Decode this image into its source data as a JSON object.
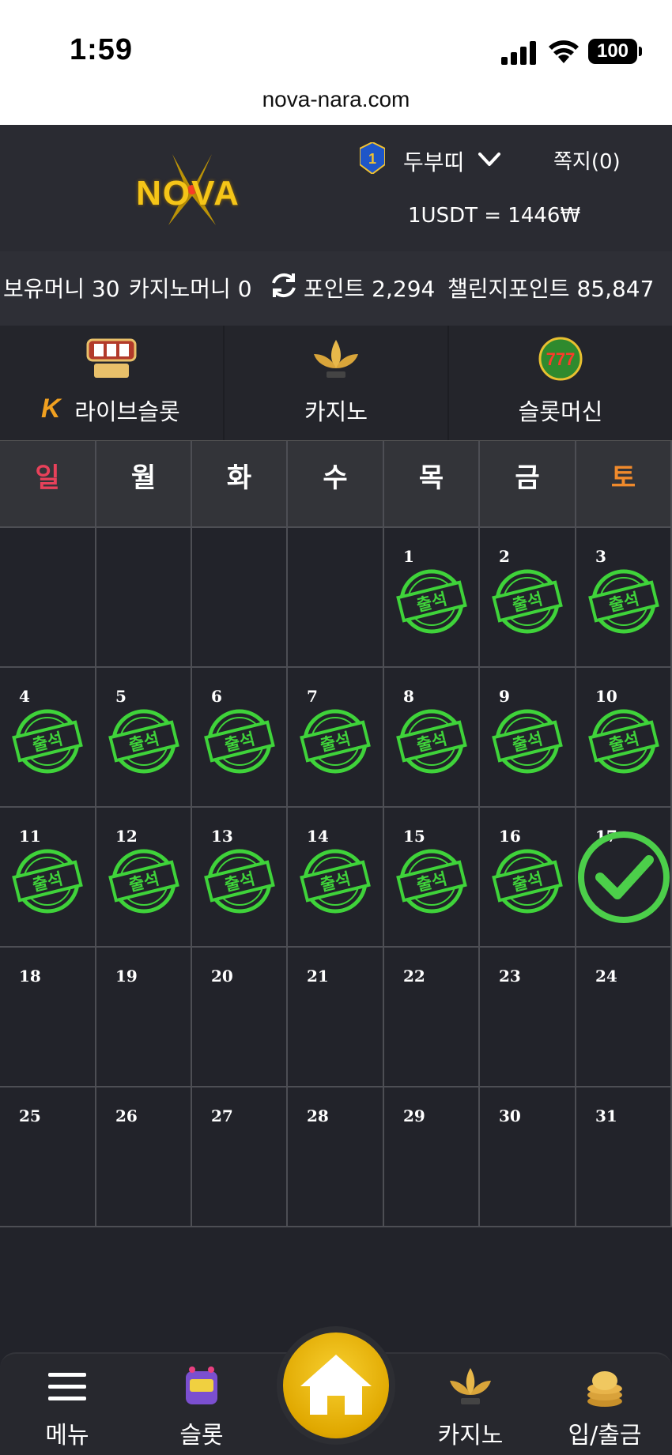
{
  "status_bar": {
    "time": "1:59",
    "battery": "100"
  },
  "browser": {
    "url": "nova-nara.com"
  },
  "header": {
    "logo_text": "NOVA",
    "rank_level": "1",
    "username": "두부띠",
    "messages": "쪽지(0)",
    "exchange_rate": "1USDT = 1446₩"
  },
  "balances": {
    "holding": "보유머니 30",
    "casino": "카지노머니 0",
    "points": "포인트 2,294",
    "challenge": "챌린지포인트 85,847"
  },
  "categories": [
    {
      "label": "라이브슬롯",
      "icon": "live-slot-icon",
      "badge": "K"
    },
    {
      "label": "카지노",
      "icon": "k-slot-lotus-icon"
    },
    {
      "label": "슬롯머신",
      "icon": "777-slots-icon"
    }
  ],
  "calendar": {
    "weekdays": [
      "일",
      "월",
      "화",
      "수",
      "목",
      "금",
      "토"
    ],
    "weekday_colors": {
      "sunday": "#e8415a",
      "saturday": "#f08a2c",
      "default": "#ffffff"
    },
    "stamp_text": "출석",
    "stamp_color": "#3fd33a",
    "today": "17",
    "weeks": [
      [
        {
          "day": "",
          "checked": false
        },
        {
          "day": "",
          "checked": false
        },
        {
          "day": "",
          "checked": false
        },
        {
          "day": "",
          "checked": false
        },
        {
          "day": "1",
          "checked": true
        },
        {
          "day": "2",
          "checked": true
        },
        {
          "day": "3",
          "checked": true
        }
      ],
      [
        {
          "day": "4",
          "checked": true
        },
        {
          "day": "5",
          "checked": true
        },
        {
          "day": "6",
          "checked": true
        },
        {
          "day": "7",
          "checked": true
        },
        {
          "day": "8",
          "checked": true
        },
        {
          "day": "9",
          "checked": true
        },
        {
          "day": "10",
          "checked": true
        }
      ],
      [
        {
          "day": "11",
          "checked": true
        },
        {
          "day": "12",
          "checked": true
        },
        {
          "day": "13",
          "checked": true
        },
        {
          "day": "14",
          "checked": true
        },
        {
          "day": "15",
          "checked": true
        },
        {
          "day": "16",
          "checked": true
        },
        {
          "day": "17",
          "checked": false,
          "today": true
        }
      ],
      [
        {
          "day": "18",
          "checked": false
        },
        {
          "day": "19",
          "checked": false
        },
        {
          "day": "20",
          "checked": false
        },
        {
          "day": "21",
          "checked": false
        },
        {
          "day": "22",
          "checked": false
        },
        {
          "day": "23",
          "checked": false
        },
        {
          "day": "24",
          "checked": false
        }
      ],
      [
        {
          "day": "25",
          "checked": false
        },
        {
          "day": "26",
          "checked": false
        },
        {
          "day": "27",
          "checked": false
        },
        {
          "day": "28",
          "checked": false
        },
        {
          "day": "29",
          "checked": false
        },
        {
          "day": "30",
          "checked": false
        },
        {
          "day": "31",
          "checked": false
        }
      ]
    ]
  },
  "bottom_nav": {
    "menu": "메뉴",
    "slot": "슬롯",
    "home": "home-icon",
    "casino": "카지노",
    "deposit": "입/출금"
  }
}
